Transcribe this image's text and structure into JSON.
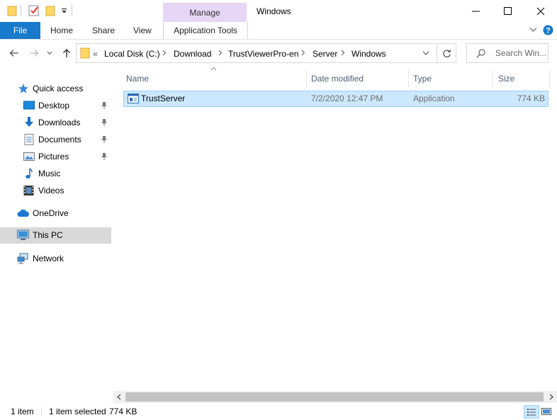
{
  "window": {
    "title": "Windows",
    "context_tab": "Manage",
    "context_group": "Application Tools"
  },
  "ribbon": {
    "tabs": [
      "File",
      "Home",
      "Share",
      "View"
    ]
  },
  "address": {
    "overflow": "«",
    "crumbs": [
      "Local Disk (C:)",
      "Download",
      "TrustViewerPro-en",
      "Server",
      "Windows"
    ]
  },
  "search": {
    "placeholder": "Search Win..."
  },
  "nav": {
    "quick_access": "Quick access",
    "pinned": [
      "Desktop",
      "Downloads",
      "Documents",
      "Pictures"
    ],
    "unpinned": [
      "Music",
      "Videos"
    ],
    "onedrive": "OneDrive",
    "this_pc": "This PC",
    "network": "Network"
  },
  "columns": {
    "name": "Name",
    "date": "Date modified",
    "type": "Type",
    "size": "Size"
  },
  "files": [
    {
      "name": "TrustServer",
      "date": "7/2/2020 12:47 PM",
      "type": "Application",
      "size": "774 KB",
      "selected": true
    }
  ],
  "status": {
    "count": "1 item",
    "selected": "1 item selected",
    "size": "774 KB"
  },
  "colors": {
    "accent": "#1979ca",
    "selection": "#cce8ff",
    "context_tab": "#e6d6f5"
  }
}
